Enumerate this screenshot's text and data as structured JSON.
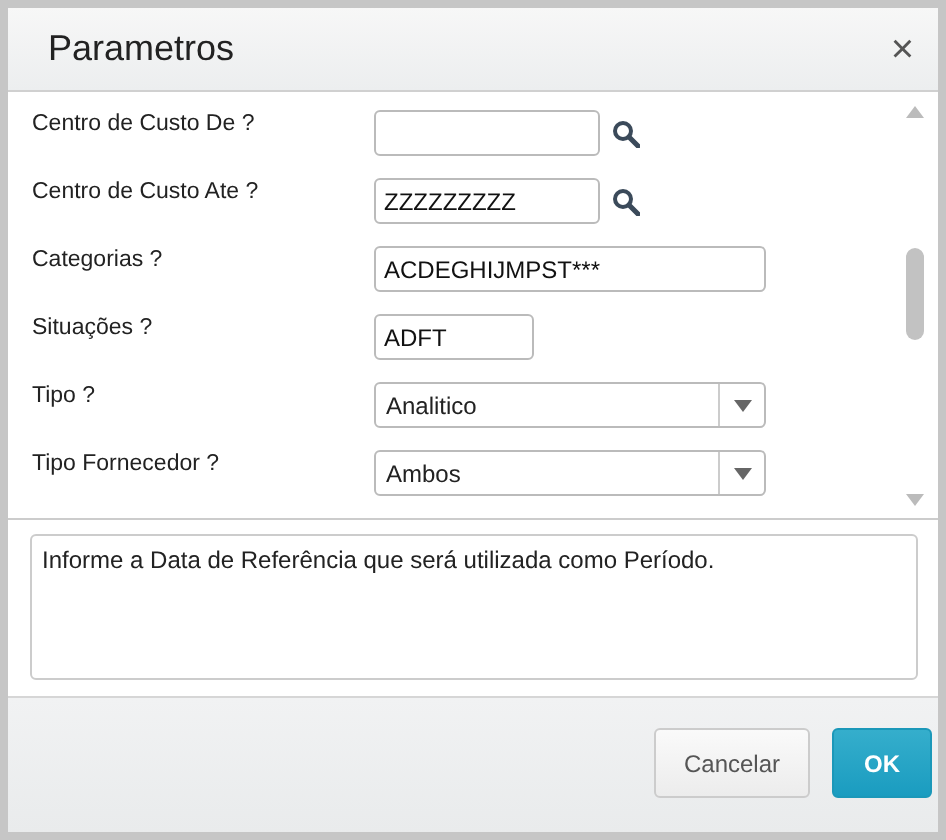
{
  "window": {
    "title": "Parametros",
    "close": "×"
  },
  "fields": [
    {
      "label": "Centro de Custo De ?",
      "kind": "search"
    },
    {
      "label": "Centro de Custo Ate ?",
      "kind": "search",
      "value": "ZZZZZZZZZ"
    },
    {
      "label": "Categorias ?",
      "kind": "text",
      "value": "ACDEGHIJMPST***"
    },
    {
      "label": "Situações ?",
      "kind": "text",
      "value": "ADFT"
    },
    {
      "label": "Tipo ?",
      "kind": "select",
      "value": "Analitico"
    },
    {
      "label": "Tipo Fornecedor ?",
      "kind": "select",
      "value": "Ambos"
    }
  ],
  "help": "Informe a Data de Referência que será utilizada como Período.",
  "buttons": [
    {
      "label": "Cancelar",
      "kind": "secondary"
    },
    {
      "label": "OK",
      "kind": "primary"
    }
  ]
}
